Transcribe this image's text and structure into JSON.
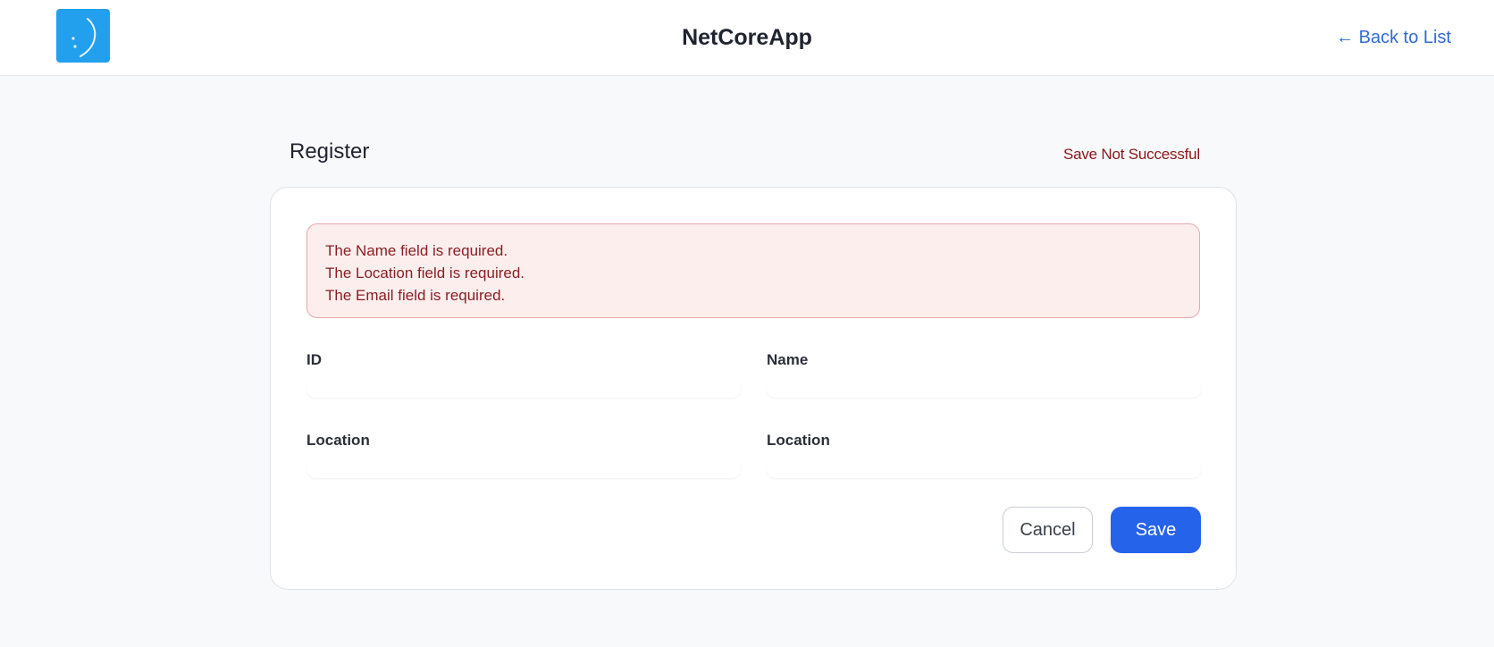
{
  "header": {
    "app_title": "NetCoreApp",
    "back_link": "← Back to List",
    "logo_icon": "smiley-face-icon",
    "logo_color": "#22a0ee"
  },
  "page": {
    "heading": "Register",
    "status_message": "Save Not Successful",
    "status_color": "#8a1616"
  },
  "errors": [
    "The Name field is required.",
    "The Location field is required.",
    "The Email field is required."
  ],
  "form": {
    "fields": [
      {
        "label": "ID",
        "value": ""
      },
      {
        "label": "Name",
        "value": ""
      },
      {
        "label": "Location",
        "value": ""
      },
      {
        "label": "Location",
        "value": ""
      }
    ]
  },
  "actions": {
    "cancel_label": "Cancel",
    "save_label": "Save",
    "primary_color": "#2563eb"
  }
}
